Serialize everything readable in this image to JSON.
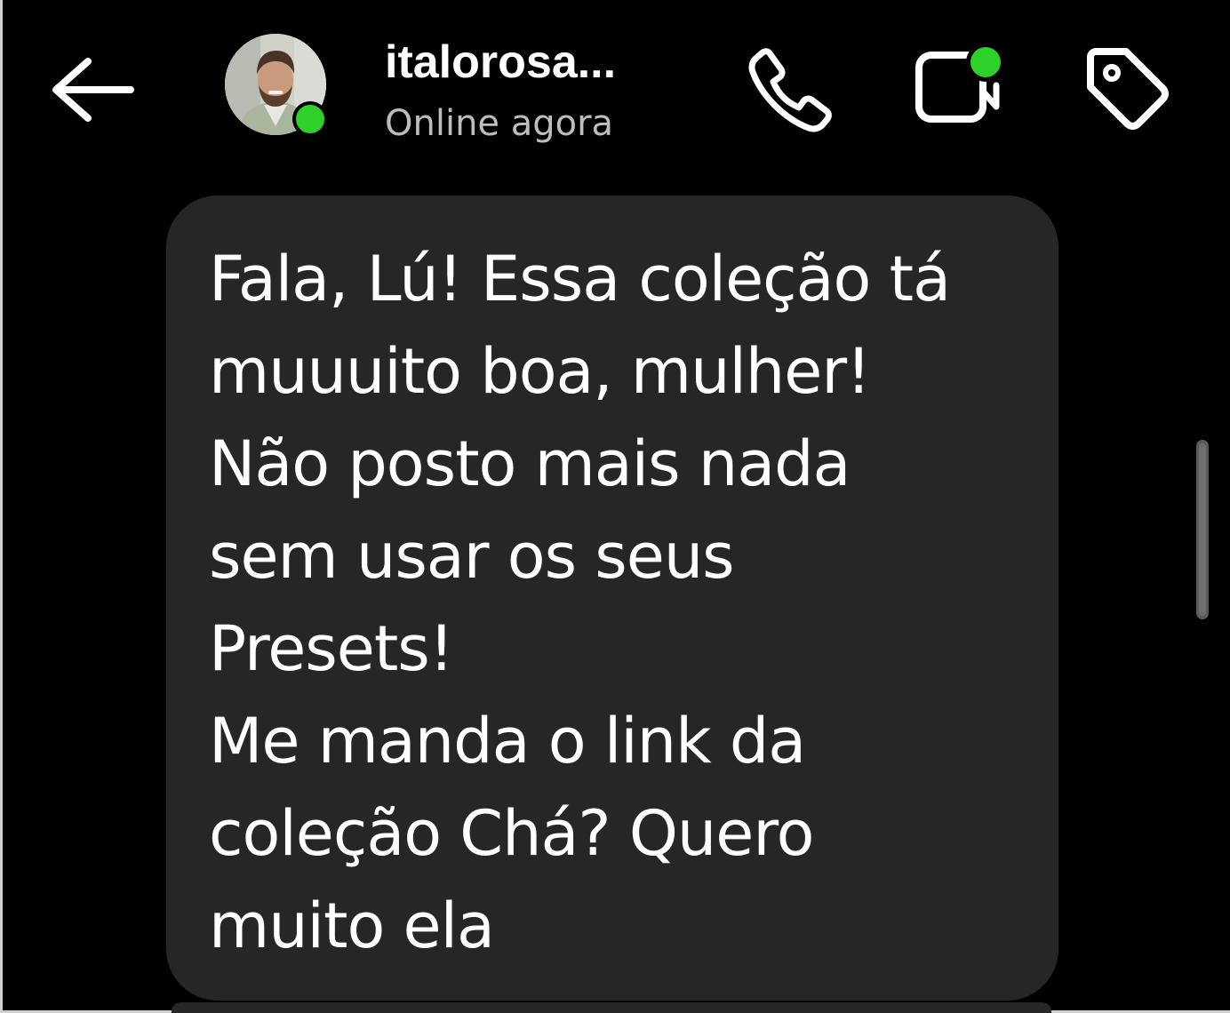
{
  "header": {
    "contact_name": "italorosa...",
    "status": "Online agora",
    "back_icon": "arrow-left-icon",
    "call_icon": "phone-icon",
    "video_icon": "video-camera-icon",
    "tag_icon": "tag-icon"
  },
  "message": {
    "text": "Fala, Lú! Essa coleção tá\nmuuuito boa, mulher!\nNão posto mais nada\nsem usar os seus\nPresets!\nMe manda o link da\ncoleção Chá? Quero\nmuito ela"
  },
  "colors": {
    "background": "#000000",
    "bubble": "#262626",
    "online_green": "#2ed12a",
    "status_text": "#bdbdbd"
  }
}
